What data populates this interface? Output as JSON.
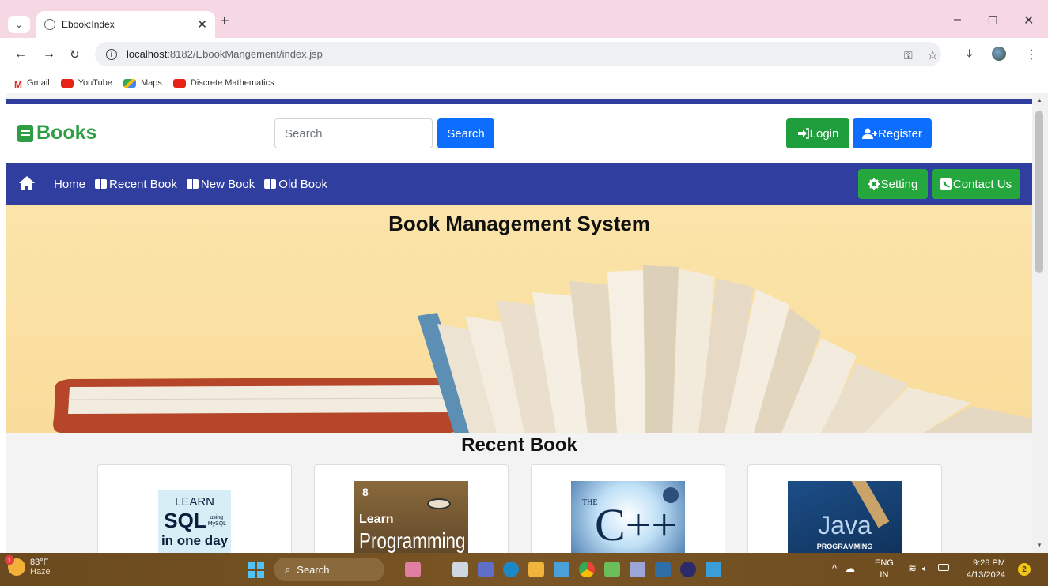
{
  "browser": {
    "tab_title": "Ebook:Index",
    "url_host": "localhost",
    "url_path": ":8182/EbookMangement/index.jsp",
    "bookmarks": [
      "Gmail",
      "YouTube",
      "Maps",
      "Discrete Mathematics"
    ]
  },
  "header": {
    "brand": "Books",
    "search_placeholder": "Search",
    "search_button": "Search",
    "login": "Login",
    "register": "Register"
  },
  "nav": {
    "home": "Home",
    "recent": "Recent Book",
    "new": "New Book",
    "old": "Old Book",
    "setting": "Setting",
    "contact": "Contact Us"
  },
  "hero": {
    "title": "Book Management System"
  },
  "recent": {
    "title": "Recent Book",
    "covers": [
      {
        "lines": [
          "LEARN",
          "SQL",
          "in one day"
        ],
        "sub": "using MySQL"
      },
      {
        "lines": [
          "8",
          "Learn",
          "Programming"
        ]
      },
      {
        "lines": [
          "THE",
          "C++"
        ]
      },
      {
        "lines": [
          "Java",
          "PROGRAMMING"
        ]
      }
    ]
  },
  "taskbar": {
    "temp": "83°F",
    "condition": "Haze",
    "search": "Search",
    "lang": "ENG",
    "region": "IN",
    "time": "9:28 PM",
    "date": "4/13/2024",
    "notifications": "2",
    "weather_badge": "1"
  },
  "colors": {
    "nav_blue": "#303f9f",
    "brand_green": "#2e9e44",
    "primary_blue": "#0d6efd",
    "success_green": "#24a83e"
  }
}
